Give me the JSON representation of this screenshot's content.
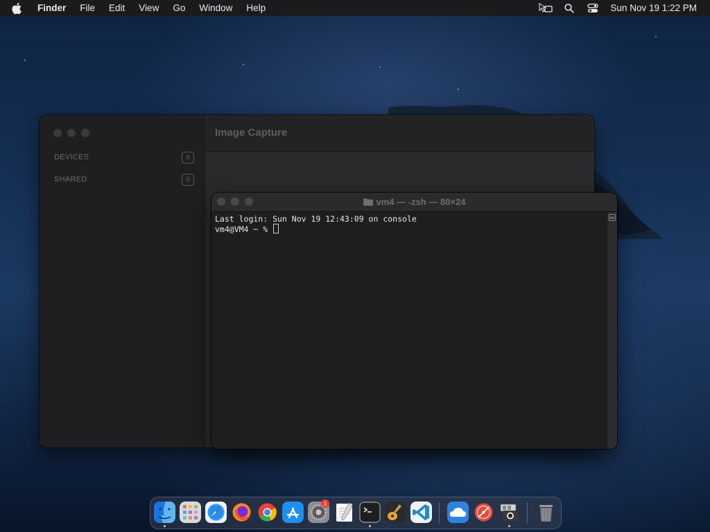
{
  "menubar": {
    "apple_icon": "apple-logo-icon",
    "app_name": "Finder",
    "items": [
      "File",
      "Edit",
      "View",
      "Go",
      "Window",
      "Help"
    ],
    "status_icons": [
      "screen-mirroring-icon",
      "search-icon",
      "control-center-icon"
    ],
    "clock": "Sun Nov 19  1:22 PM"
  },
  "image_capture": {
    "title": "Image Capture",
    "sidebar": [
      {
        "label": "DEVICES",
        "count": "0"
      },
      {
        "label": "SHARED",
        "count": "0"
      }
    ]
  },
  "terminal": {
    "title": "vm4 — -zsh — 80×24",
    "lines": [
      "Last login: Sun Nov 19 12:43:09 on console",
      "vm4@VM4 ~ % "
    ]
  },
  "dock": {
    "apps": [
      {
        "name": "Finder",
        "icon": "finder-icon",
        "running": true
      },
      {
        "name": "Launchpad",
        "icon": "launchpad-icon",
        "running": false
      },
      {
        "name": "Safari",
        "icon": "safari-icon",
        "running": false
      },
      {
        "name": "Firefox",
        "icon": "firefox-icon",
        "running": false
      },
      {
        "name": "Chrome",
        "icon": "chrome-icon",
        "running": false
      },
      {
        "name": "App Store",
        "icon": "app-store-icon",
        "running": false
      },
      {
        "name": "System Settings",
        "icon": "system-settings-icon",
        "running": false,
        "badge": "1"
      },
      {
        "name": "TextEdit",
        "icon": "textedit-icon",
        "running": false
      },
      {
        "name": "Terminal",
        "icon": "terminal-icon",
        "running": true
      },
      {
        "name": "GarageBand",
        "icon": "garageband-icon",
        "running": false
      },
      {
        "name": "VS Code",
        "icon": "vscode-icon",
        "running": false
      },
      {
        "name": "Weather",
        "icon": "weather-icon",
        "running": false
      },
      {
        "name": "Grapher",
        "icon": "grapher-icon",
        "running": false
      },
      {
        "name": "Image Capture",
        "icon": "image-capture-icon",
        "running": true
      },
      {
        "name": "Trash",
        "icon": "trash-icon",
        "running": false
      }
    ]
  },
  "colors": {
    "menubar_bg": "#1b1b1d",
    "window_bg": "#1c1c1e",
    "terminal_bg": "#1e1e1e",
    "badge_red": "#e8413a"
  }
}
